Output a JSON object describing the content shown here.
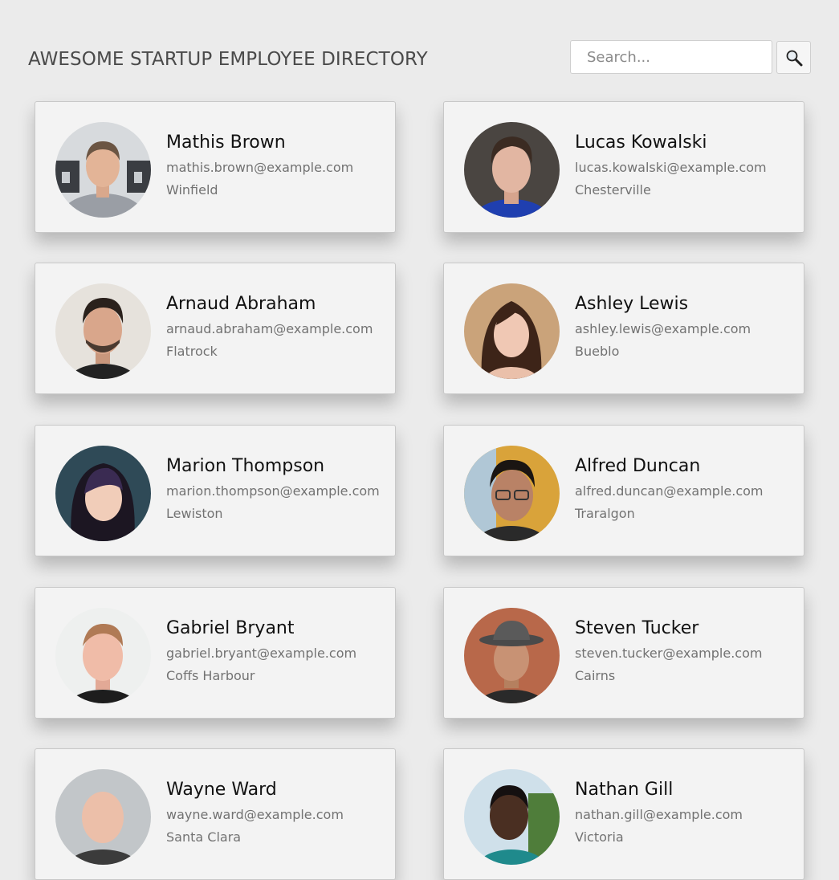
{
  "header": {
    "title": "AWESOME STARTUP EMPLOYEE DIRECTORY",
    "search_placeholder": "Search...",
    "search_icon": "magnifier-icon"
  },
  "employees": [
    {
      "name": "Mathis Brown",
      "email": "mathis.brown@example.com",
      "city": "Winfield"
    },
    {
      "name": "Lucas Kowalski",
      "email": "lucas.kowalski@example.com",
      "city": "Chesterville"
    },
    {
      "name": "Arnaud Abraham",
      "email": "arnaud.abraham@example.com",
      "city": "Flatrock"
    },
    {
      "name": "Ashley Lewis",
      "email": "ashley.lewis@example.com",
      "city": "Bueblo"
    },
    {
      "name": "Marion Thompson",
      "email": "marion.thompson@example.com",
      "city": "Lewiston"
    },
    {
      "name": "Alfred Duncan",
      "email": "alfred.duncan@example.com",
      "city": "Traralgon"
    },
    {
      "name": "Gabriel Bryant",
      "email": "gabriel.bryant@example.com",
      "city": "Coffs Harbour"
    },
    {
      "name": "Steven Tucker",
      "email": "steven.tucker@example.com",
      "city": "Cairns"
    },
    {
      "name": "Wayne Ward",
      "email": "wayne.ward@example.com",
      "city": "Santa Clara"
    },
    {
      "name": "Nathan Gill",
      "email": "nathan.gill@example.com",
      "city": "Victoria"
    }
  ],
  "colors": {
    "background": "#ebebeb",
    "card": "#f3f3f3",
    "name_text": "#111111",
    "detail_text": "#727272"
  }
}
